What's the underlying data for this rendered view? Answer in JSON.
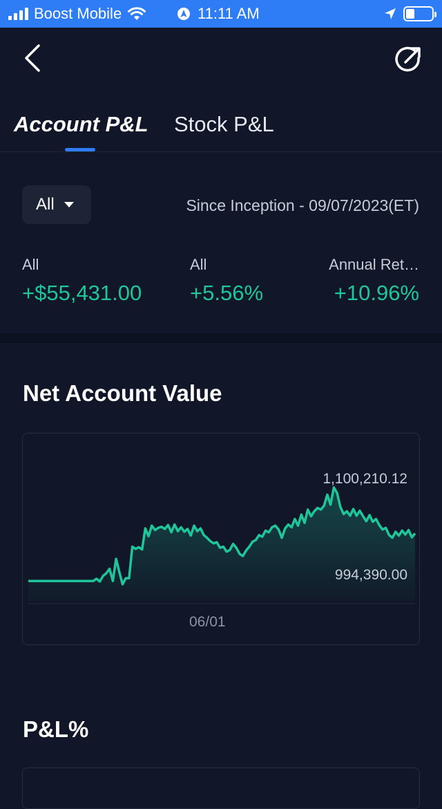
{
  "status_bar": {
    "carrier": "Boost Mobile",
    "time": "11:11 AM"
  },
  "tabs": {
    "active": "Account P&L",
    "inactive": "Stock P&L"
  },
  "filter": {
    "selected": "All"
  },
  "period": "Since Inception - 09/07/2023(ET)",
  "stats": [
    {
      "label": "All",
      "value": "+$55,431.00"
    },
    {
      "label": "All",
      "value": "+5.56%"
    },
    {
      "label": "Annual Ret…",
      "value": "+10.96%"
    }
  ],
  "net_account_value": {
    "title": "Net Account Value",
    "max_label": "1,100,210.12",
    "min_label": "994,390.00",
    "x_label": "06/01"
  },
  "pl_percent": {
    "title": "P&L%"
  },
  "colors": {
    "accent": "#2f7df6",
    "positive": "#1fc69a",
    "background": "#111728"
  },
  "chart_data": {
    "type": "area",
    "title": "Net Account Value",
    "xlabel": "",
    "ylabel": "",
    "ylim": [
      994390.0,
      1100210.12
    ],
    "x_tick_labels": [
      "06/01"
    ],
    "series": [
      {
        "values": [
          1000000,
          1000000,
          1000000,
          1000000,
          1000000,
          1000000,
          1000000,
          1000000,
          1000000,
          1000000,
          1000000,
          1000000,
          1000000,
          1000000,
          1000000,
          1000000,
          1000000,
          1000000,
          1000000,
          1000000,
          1000000,
          1002000,
          999500,
          1004500,
          1007000,
          1011000,
          1000000,
          1020000,
          1008000,
          997000,
          1002500,
          1002500,
          1031000,
          1029000,
          1030500,
          1028500,
          1047500,
          1040500,
          1050000,
          1046000,
          1048000,
          1049000,
          1047000,
          1050500,
          1044000,
          1051000,
          1045000,
          1048500,
          1044500,
          1047000,
          1041000,
          1050000,
          1045000,
          1047500,
          1041500,
          1039000,
          1036000,
          1034000,
          1035000,
          1030000,
          1031000,
          1026500,
          1028000,
          1033500,
          1030000,
          1024500,
          1022500,
          1027500,
          1031000,
          1035500,
          1037000,
          1041500,
          1040000,
          1045500,
          1044000,
          1048500,
          1050000,
          1046500,
          1039000,
          1047500,
          1051000,
          1048500,
          1056000,
          1050000,
          1060000,
          1052500,
          1064500,
          1058500,
          1063000,
          1066000,
          1064500,
          1068000,
          1078000,
          1069000,
          1084500,
          1079500,
          1067000,
          1060500,
          1063000,
          1059000,
          1065000,
          1059000,
          1063500,
          1058500,
          1054000,
          1059500,
          1053500,
          1056000,
          1050500,
          1046500,
          1048000,
          1041500,
          1039000,
          1044500,
          1041000,
          1045500,
          1042000,
          1046000,
          1039500,
          1043000
        ]
      }
    ]
  }
}
